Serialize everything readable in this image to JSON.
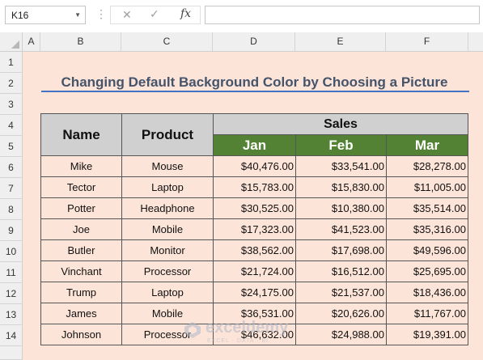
{
  "formula_bar": {
    "name_box": "K16",
    "cancel_icon": "✕",
    "enter_icon": "✓",
    "fx_label": "fx",
    "formula": ""
  },
  "columns": [
    "A",
    "B",
    "C",
    "D",
    "E",
    "F"
  ],
  "rows": [
    "1",
    "2",
    "3",
    "4",
    "5",
    "6",
    "7",
    "8",
    "9",
    "10",
    "11",
    "12",
    "13",
    "14"
  ],
  "title": "Changing Default Background Color by Choosing a Picture",
  "table": {
    "name_header": "Name",
    "product_header": "Product",
    "sales_header": "Sales",
    "months": [
      "Jan",
      "Feb",
      "Mar"
    ],
    "records": [
      {
        "name": "Mike",
        "product": "Mouse",
        "jan": "$40,476.00",
        "feb": "$33,541.00",
        "mar": "$28,278.00"
      },
      {
        "name": "Tector",
        "product": "Laptop",
        "jan": "$15,783.00",
        "feb": "$15,830.00",
        "mar": "$11,005.00"
      },
      {
        "name": "Potter",
        "product": "Headphone",
        "jan": "$30,525.00",
        "feb": "$10,380.00",
        "mar": "$35,514.00"
      },
      {
        "name": "Joe",
        "product": "Mobile",
        "jan": "$17,323.00",
        "feb": "$41,523.00",
        "mar": "$35,316.00"
      },
      {
        "name": "Butler",
        "product": "Monitor",
        "jan": "$38,562.00",
        "feb": "$17,698.00",
        "mar": "$49,596.00"
      },
      {
        "name": "Vinchant",
        "product": "Processor",
        "jan": "$21,724.00",
        "feb": "$16,512.00",
        "mar": "$25,695.00"
      },
      {
        "name": "Trump",
        "product": "Laptop",
        "jan": "$24,175.00",
        "feb": "$21,537.00",
        "mar": "$18,436.00"
      },
      {
        "name": "James",
        "product": "Mobile",
        "jan": "$36,531.00",
        "feb": "$20,626.00",
        "mar": "$11,767.00"
      },
      {
        "name": "Johnson",
        "product": "Processor",
        "jan": "$46,632.00",
        "feb": "$24,988.00",
        "mar": "$19,391.00"
      }
    ]
  },
  "watermark": {
    "name": "exceldemy",
    "tagline": "EXCEL · DATA · BI"
  },
  "colors": {
    "sheet_background": "#fde4d8",
    "month_header": "#548235",
    "header_gray": "#d0d0d0",
    "title_text": "#44546a",
    "title_underline": "#4472c4"
  }
}
